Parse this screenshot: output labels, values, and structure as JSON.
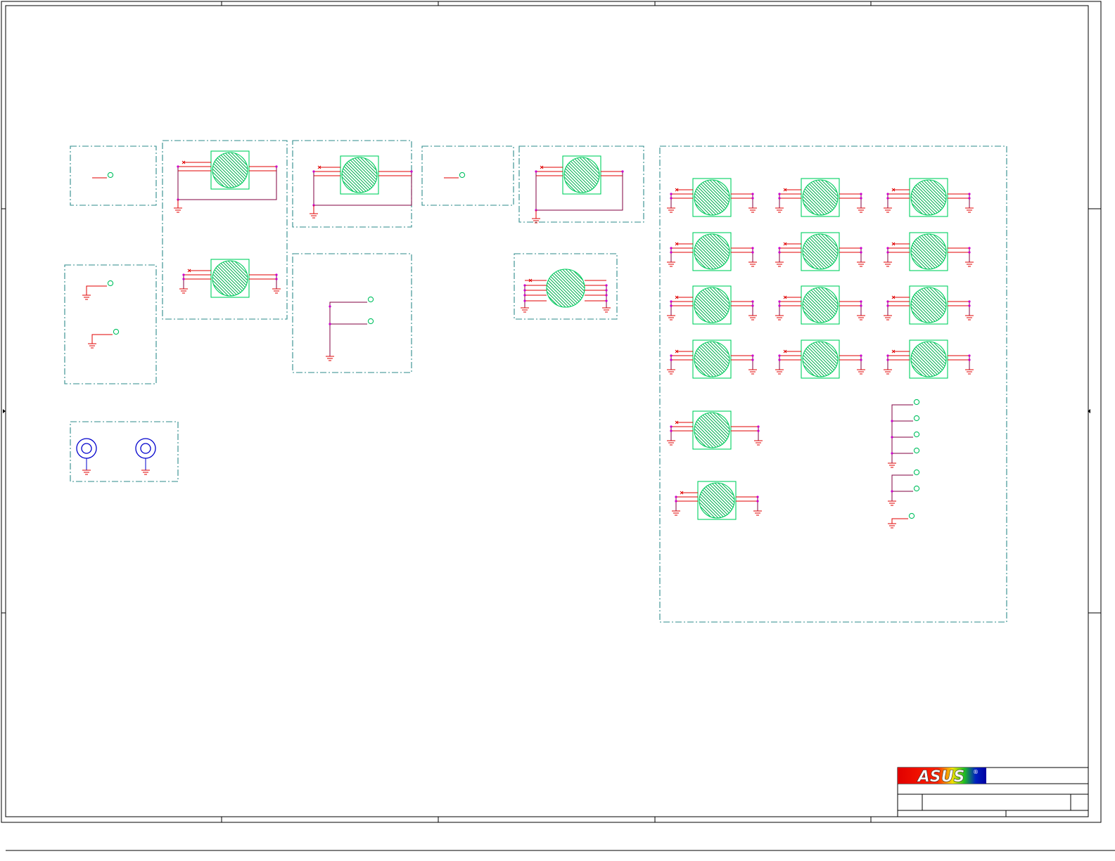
{
  "colors": {
    "frame": "#000000",
    "group_border": "#2e8b8b",
    "component": "#00d060",
    "hatch": "#00b050",
    "pin": "#e00000",
    "net": "#800040",
    "junction": "#cc00cc",
    "ground": "#e00000",
    "testpoint": "#00c060",
    "jack": "#0000cc"
  },
  "logo": {
    "brand": "ASUS",
    "registered": "®"
  }
}
